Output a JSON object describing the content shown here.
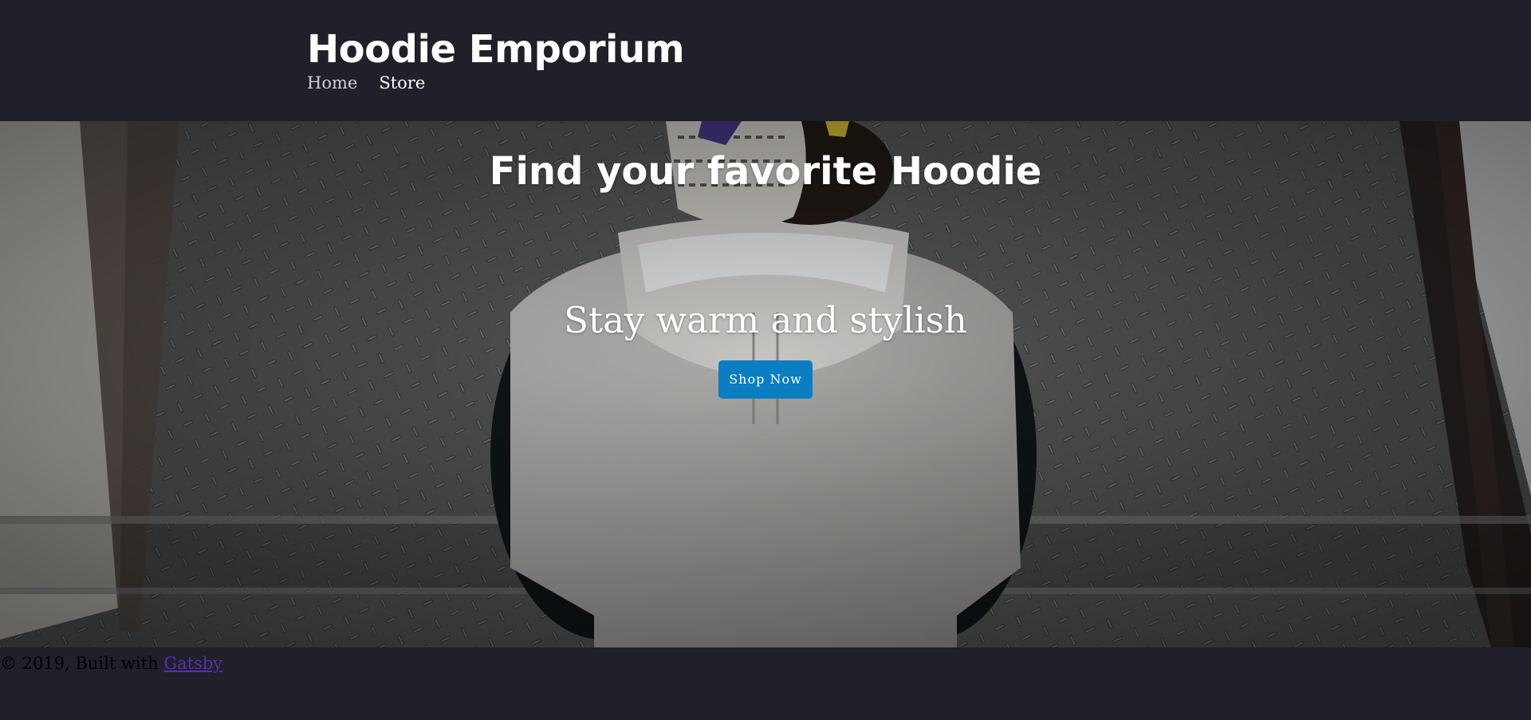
{
  "header": {
    "site_title": "Hoodie Emporium",
    "nav": [
      {
        "label": "Home"
      },
      {
        "label": "Store"
      }
    ]
  },
  "hero": {
    "headline": "Find your favorite Hoodie",
    "subheadline": "Stay warm and stylish",
    "cta_label": "Shop Now",
    "image_subject": "person-in-gray-hoodie-sitting-on-metal-stairs"
  },
  "footer": {
    "copyright": "© 2019, Built with",
    "link_label": "Gatsby"
  },
  "colors": {
    "header_bg": "#1f2029",
    "cta_bg": "#0b7dc1",
    "link": "#5d2fb1"
  }
}
